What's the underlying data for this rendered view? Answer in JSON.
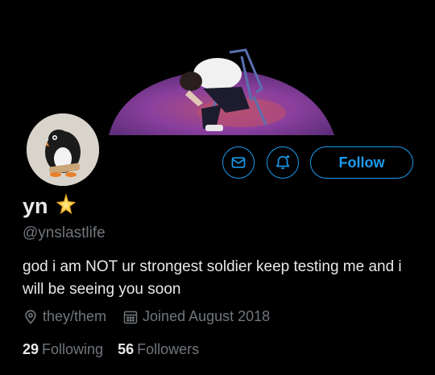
{
  "profile": {
    "name": "yn",
    "handle": "@ynslastlife",
    "bio": "god i am NOT ur strongest soldier keep testing me and i will be seeing you soon",
    "pronouns": "they/them",
    "joined": "Joined August 2018",
    "following_count": "29",
    "following_label": "Following",
    "followers_count": "56",
    "followers_label": "Followers"
  },
  "actions": {
    "follow_label": "Follow",
    "message_icon": "mail-icon",
    "notify_icon": "bell-plus-icon"
  },
  "colors": {
    "accent": "#1d9bf0",
    "secondary_text": "#71767b",
    "background": "#000000",
    "banner_purple": "#7b3f9a"
  }
}
